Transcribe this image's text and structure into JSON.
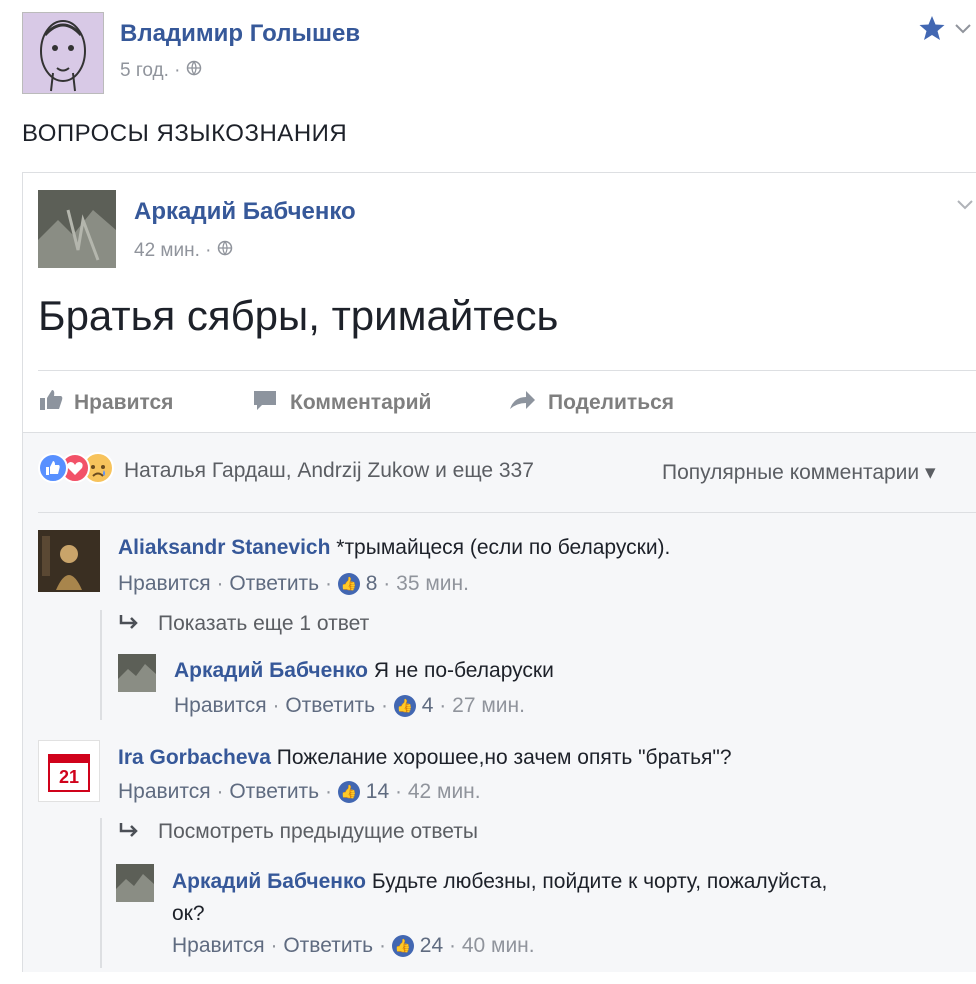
{
  "post": {
    "author": "Владимир Голышев",
    "time": "5 год.",
    "text": "ВОПРОСЫ ЯЗЫКОЗНАНИЯ"
  },
  "shared": {
    "author": "Аркадий Бабченко",
    "time": "42 мин.",
    "text": "Братья сябры, тримайтесь",
    "actions": {
      "like": "Нравится",
      "comment": "Комментарий",
      "share": "Поделиться"
    },
    "reactions_text": "Наталья Гардаш, Andrzij Zukow и еще 337",
    "sort_label": "Популярные комментарии"
  },
  "comments": [
    {
      "name": "Aliaksandr Stanevich",
      "text": "*трымайцеся (если по беларуски).",
      "like": "Нравится",
      "reply": "Ответить",
      "likes": "8",
      "time": "35 мин."
    },
    {
      "show_more": "Показать еще 1 ответ"
    },
    {
      "name": "Аркадий Бабченко",
      "text": "Я не по-беларуски",
      "like": "Нравится",
      "reply": "Ответить",
      "likes": "4",
      "time": "27 мин."
    },
    {
      "name": "Ira Gorbacheva",
      "text": "Пожелание хорошее,но зачем опять \"братья\"?",
      "like": "Нравится",
      "reply": "Ответить",
      "likes": "14",
      "time": "42 мин.",
      "calendar_day": "21"
    },
    {
      "show_more": "Посмотреть предыдущие ответы"
    },
    {
      "name": "Аркадий Бабченко",
      "text_line1": "Будьте любезны, пойдите к чорту, пожалуйста,",
      "text_line2": "ок?",
      "like": "Нравится",
      "reply": "Ответить",
      "likes": "24",
      "time": "40 мин."
    }
  ],
  "colors": {
    "link": "#365899",
    "meta": "#90949c",
    "like_blue": "#4267b2",
    "border": "#dddfe2",
    "star": "#4267b2"
  }
}
